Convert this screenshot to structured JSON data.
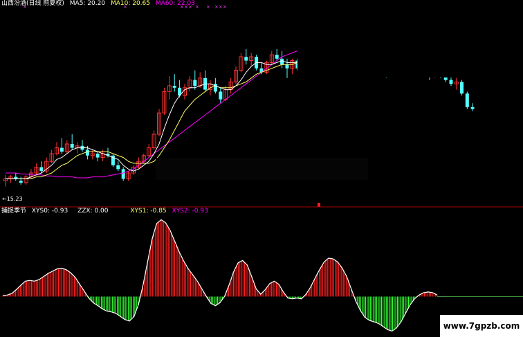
{
  "header": {
    "stock_title": "山西汾酒(日线 前复权)",
    "ma5_label": "MA5: 20.20",
    "ma10_label": "MA10: 20.65",
    "ma60_label": "MA60: 22.03",
    "low_price_label": "←15.23"
  },
  "indicator": {
    "name": "捕捉季节",
    "xys0_label": "XYS0: -0.93",
    "zzx_label": "ZZX: 0.00",
    "xys1_label": "XYS1: -0.85",
    "xys2_label": "XYS2: -0.93"
  },
  "watermark": "www.7gpzb.com",
  "colors": {
    "background": "#000000",
    "up_candle": "#ff3232",
    "down_candle": "#54ffff",
    "ma5": "#ffffff",
    "ma10": "#ffff66",
    "ma60": "#ff00ff",
    "positive_bar": "#ff2020",
    "negative_bar": "#33ff33",
    "divider": "#aa0000"
  },
  "chart_data": [
    {
      "type": "candlestick",
      "title": "山西汾酒(日线 前复权)",
      "ylim": [
        14.5,
        24.5
      ],
      "candles": [
        [
          15.6,
          15.9,
          15.3,
          15.7
        ],
        [
          15.7,
          15.9,
          15.5,
          15.8
        ],
        [
          15.8,
          16.0,
          15.6,
          15.7
        ],
        [
          15.6,
          15.8,
          15.4,
          15.5
        ],
        [
          15.5,
          15.9,
          15.4,
          15.8
        ],
        [
          15.8,
          16.2,
          15.7,
          16.0
        ],
        [
          16.0,
          16.5,
          15.9,
          16.3
        ],
        [
          16.3,
          16.6,
          16.0,
          16.1
        ],
        [
          16.1,
          16.8,
          16.0,
          16.6
        ],
        [
          16.6,
          17.2,
          16.5,
          17.0
        ],
        [
          17.0,
          17.6,
          16.9,
          17.3
        ],
        [
          17.3,
          17.8,
          17.0,
          17.1
        ],
        [
          17.1,
          17.7,
          17.0,
          17.5
        ],
        [
          17.5,
          18.0,
          17.2,
          17.3
        ],
        [
          17.3,
          17.6,
          17.0,
          17.4
        ],
        [
          17.4,
          17.7,
          17.1,
          17.2
        ],
        [
          17.2,
          17.4,
          16.7,
          16.9
        ],
        [
          16.9,
          17.2,
          16.7,
          17.0
        ],
        [
          17.0,
          17.1,
          16.6,
          16.8
        ],
        [
          16.8,
          17.2,
          16.6,
          17.0
        ],
        [
          17.0,
          17.3,
          16.8,
          16.9
        ],
        [
          16.9,
          17.0,
          16.3,
          16.4
        ],
        [
          16.4,
          16.6,
          16.1,
          16.2
        ],
        [
          16.2,
          16.3,
          15.6,
          15.7
        ],
        [
          15.7,
          16.1,
          15.6,
          16.0
        ],
        [
          16.0,
          16.4,
          15.9,
          16.3
        ],
        [
          16.3,
          16.8,
          16.2,
          16.6
        ],
        [
          16.6,
          17.0,
          16.5,
          16.9
        ],
        [
          16.9,
          17.5,
          16.8,
          17.3
        ],
        [
          17.3,
          18.2,
          17.2,
          18.0
        ],
        [
          18.0,
          19.3,
          17.9,
          19.1
        ],
        [
          19.1,
          20.4,
          19.0,
          20.2
        ],
        [
          20.2,
          21.0,
          19.8,
          20.5
        ],
        [
          20.5,
          21.1,
          20.2,
          20.4
        ],
        [
          20.4,
          20.8,
          19.9,
          20.0
        ],
        [
          20.0,
          20.6,
          19.8,
          20.4
        ],
        [
          20.4,
          21.0,
          20.2,
          20.8
        ],
        [
          20.8,
          21.3,
          20.3,
          20.5
        ],
        [
          20.5,
          21.2,
          20.4,
          20.9
        ],
        [
          20.9,
          21.3,
          20.2,
          20.3
        ],
        [
          20.3,
          20.8,
          20.0,
          20.6
        ],
        [
          20.6,
          20.9,
          20.1,
          20.2
        ],
        [
          20.2,
          20.4,
          19.6,
          19.8
        ],
        [
          19.8,
          20.5,
          19.7,
          20.3
        ],
        [
          20.3,
          20.9,
          20.1,
          20.7
        ],
        [
          20.7,
          21.5,
          20.6,
          21.3
        ],
        [
          21.3,
          22.2,
          21.2,
          22.0
        ],
        [
          22.0,
          22.4,
          21.6,
          21.8
        ],
        [
          21.8,
          22.2,
          21.5,
          22.0
        ],
        [
          22.0,
          22.1,
          21.3,
          21.4
        ],
        [
          21.4,
          21.7,
          21.1,
          21.2
        ],
        [
          21.2,
          21.8,
          21.1,
          21.7
        ],
        [
          21.7,
          22.3,
          21.6,
          22.1
        ],
        [
          22.1,
          22.4,
          21.8,
          21.9
        ],
        [
          21.9,
          22.3,
          21.4,
          21.6
        ],
        [
          21.6,
          21.9,
          20.9,
          21.4
        ],
        [
          21.4,
          21.9,
          21.1,
          21.8
        ],
        [
          21.8,
          21.9,
          21.3,
          21.4
        ],
        [
          21.4,
          21.7,
          21.3,
          21.5
        ]
      ],
      "candles_right_section": [
        [
          21.7,
          22.0,
          21.3,
          21.5
        ],
        [
          21.5,
          21.8,
          20.9,
          21.1
        ],
        [
          21.1,
          21.6,
          21.0,
          21.5
        ],
        [
          21.5,
          21.8,
          21.2,
          21.3
        ],
        [
          21.3,
          21.7,
          21.1,
          21.6
        ],
        [
          21.6,
          21.8,
          21.3,
          21.5
        ],
        [
          21.5,
          21.7,
          21.2,
          21.3
        ],
        [
          21.3,
          21.6,
          21.1,
          21.4
        ],
        [
          21.4,
          21.6,
          21.0,
          21.2
        ],
        [
          21.2,
          21.4,
          20.8,
          21.0
        ],
        [
          21.0,
          21.3,
          20.9,
          21.1
        ],
        [
          21.1,
          21.4,
          20.9,
          21.0
        ],
        [
          21.0,
          21.2,
          20.7,
          20.8
        ],
        [
          20.8,
          21.0,
          20.5,
          20.6
        ],
        [
          20.6,
          20.9,
          20.3,
          20.7
        ],
        [
          20.7,
          20.8,
          20.0,
          20.1
        ],
        [
          20.1,
          20.2,
          19.3,
          19.4
        ],
        [
          19.4,
          19.6,
          19.2,
          19.3
        ]
      ],
      "ma5": [
        15.7,
        15.7,
        15.7,
        15.7,
        15.7,
        15.8,
        15.9,
        16.0,
        16.2,
        16.4,
        16.7,
        16.8,
        17.0,
        17.2,
        17.3,
        17.3,
        17.3,
        17.2,
        17.1,
        17.0,
        16.9,
        16.8,
        16.7,
        16.4,
        16.2,
        16.1,
        16.2,
        16.4,
        16.6,
        17.0,
        17.5,
        18.3,
        19.0,
        19.6,
        20.0,
        20.3,
        20.4,
        20.4,
        20.5,
        20.6,
        20.6,
        20.5,
        20.4,
        20.3,
        20.3,
        20.5,
        20.8,
        21.2,
        21.5,
        21.7,
        21.7,
        21.6,
        21.6,
        21.7,
        21.8,
        21.7,
        21.7,
        21.7,
        21.6
      ],
      "ma10": [
        15.7,
        15.7,
        15.7,
        15.7,
        15.7,
        15.7,
        15.8,
        15.8,
        15.9,
        16.0,
        16.2,
        16.4,
        16.5,
        16.7,
        16.9,
        17.0,
        17.1,
        17.1,
        17.1,
        17.1,
        17.1,
        17.0,
        16.9,
        16.8,
        16.6,
        16.5,
        16.5,
        16.5,
        16.5,
        16.6,
        16.9,
        17.3,
        17.7,
        18.2,
        18.7,
        19.2,
        19.5,
        19.8,
        20.0,
        20.2,
        20.4,
        20.5,
        20.4,
        20.4,
        20.4,
        20.5,
        20.6,
        20.7,
        20.9,
        21.1,
        21.2,
        21.3,
        21.4,
        21.5,
        21.6,
        21.6,
        21.6,
        21.7,
        21.7
      ],
      "ma60": [
        16.0,
        16.0,
        16.0,
        15.95,
        15.95,
        15.9,
        15.9,
        15.9,
        15.85,
        15.85,
        15.8,
        15.8,
        15.8,
        15.8,
        15.75,
        15.75,
        15.75,
        15.8,
        15.8,
        15.8,
        15.85,
        15.9,
        15.95,
        16.0,
        16.1,
        16.2,
        16.4,
        16.6,
        16.8,
        17.0,
        17.2,
        17.4,
        17.6,
        17.8,
        18.0,
        18.2,
        18.4,
        18.6,
        18.8,
        19.0,
        19.2,
        19.4,
        19.6,
        19.8,
        20.0,
        20.2,
        20.4,
        20.6,
        20.8,
        21.0,
        21.2,
        21.4,
        21.6,
        21.8,
        22.0,
        22.1,
        22.2,
        22.3,
        22.4
      ]
    },
    {
      "type": "bar",
      "title": "捕捉季节",
      "series_xys0": [
        0.1,
        0.2,
        0.4,
        0.9,
        1.5,
        2.0,
        2.1,
        2.0,
        2.2,
        2.6,
        3.0,
        3.3,
        3.6,
        3.7,
        3.5,
        3.1,
        2.5,
        1.6,
        0.7,
        -0.2,
        -0.8,
        -1.2,
        -1.6,
        -1.9,
        -2.0,
        -2.2,
        -2.6,
        -3.0,
        -3.2,
        -2.6,
        -1.0,
        1.5,
        4.5,
        7.5,
        9.5,
        10.0,
        9.6,
        8.6,
        7.2,
        5.8,
        4.6,
        3.6,
        2.8,
        2.0,
        1.0,
        0.0,
        -0.9,
        -1.2,
        -0.8,
        0.0,
        1.5,
        3.2,
        4.4,
        4.7,
        4.1,
        2.6,
        1.0,
        0.3,
        0.9,
        1.7,
        2.0,
        1.6,
        0.6,
        -0.2,
        -0.3,
        -0.2,
        -0.3,
        0.3,
        1.2,
        2.4,
        3.5,
        4.5,
        5.0,
        4.9,
        4.5,
        3.7,
        2.6,
        1.0,
        -0.6,
        -1.8,
        -2.7,
        -3.1,
        -3.3,
        -3.5,
        -3.9,
        -4.3,
        -4.5,
        -4.1,
        -3.3,
        -2.2,
        -1.1,
        -0.3,
        0.2,
        0.5,
        0.6,
        0.5,
        0.2
      ],
      "ylim": [
        -5.0,
        10.5
      ]
    }
  ]
}
